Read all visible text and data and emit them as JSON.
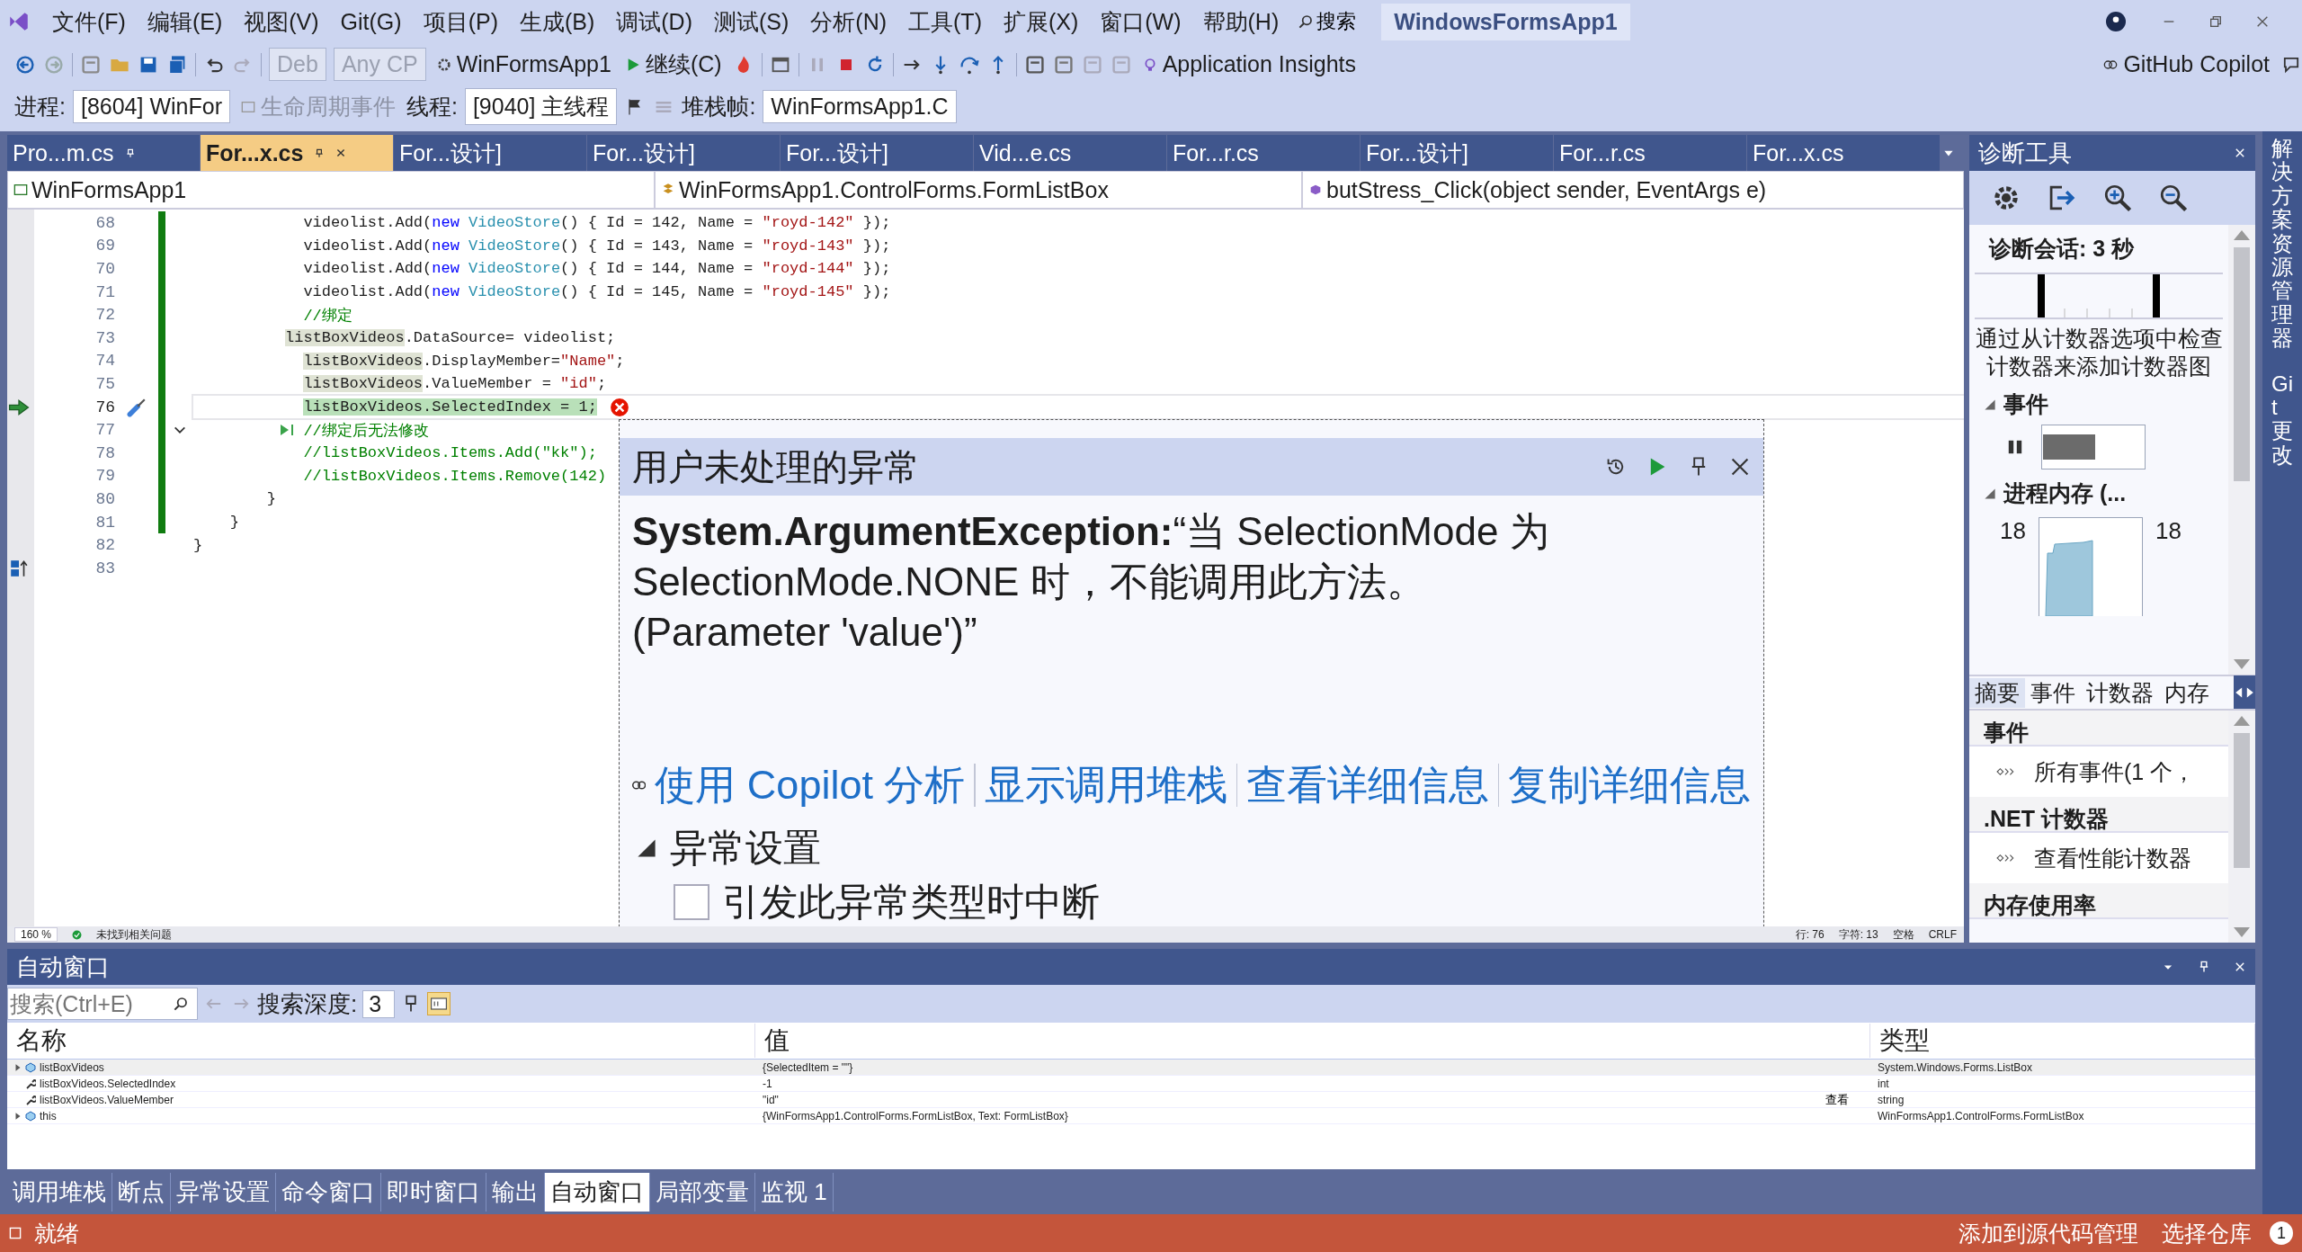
{
  "menu": [
    "文件(F)",
    "编辑(E)",
    "视图(V)",
    "Git(G)",
    "项目(P)",
    "生成(B)",
    "调试(D)",
    "测试(S)",
    "分析(N)",
    "工具(T)",
    "扩展(X)",
    "窗口(W)",
    "帮助(H)"
  ],
  "search_button": "搜索",
  "window_title": "WindowsFormsApp1",
  "toolbar": {
    "configuration": "Deb",
    "platform": "Any CP",
    "startup_project": "WinFormsApp1",
    "continue_button": "继续(C)",
    "insights_button": "Application Insights",
    "copilot_button": "GitHub Copilot"
  },
  "debug_location": {
    "process_label": "进程:",
    "process": "[8604] WinFor",
    "lifecycle_events": "生命周期事件",
    "thread_label": "线程:",
    "thread": "[9040] 主线程",
    "stack_frame_label": "堆栈帧:",
    "stack_frame": "WinFormsApp1.C"
  },
  "document_tabs": [
    {
      "label": "Pro...m.cs",
      "selected": false,
      "pinned": true
    },
    {
      "label": "For...x.cs",
      "selected": true,
      "pinned": false
    },
    {
      "label": "For...设计]",
      "selected": false,
      "pinned": false
    },
    {
      "label": "For...设计]",
      "selected": false,
      "pinned": false
    },
    {
      "label": "For...设计]",
      "selected": false,
      "pinned": false
    },
    {
      "label": "Vid...e.cs",
      "selected": false,
      "pinned": false
    },
    {
      "label": "For...r.cs",
      "selected": false,
      "pinned": false
    },
    {
      "label": "For...设计]",
      "selected": false,
      "pinned": false
    },
    {
      "label": "For...r.cs",
      "selected": false,
      "pinned": false
    },
    {
      "label": "For...x.cs",
      "selected": false,
      "pinned": false
    }
  ],
  "nav_bar": {
    "project": "WinFormsApp1",
    "type": "WinFormsApp1.ControlForms.FormListBox",
    "member": "butStress_Click(object sender, EventArgs e)"
  },
  "code_lines": [
    {
      "number": "68",
      "kind": "plain",
      "changed": true,
      "segments": [
        {
          "text": "            videolist.Add(",
          "kind": "plain"
        },
        {
          "text": "new",
          "kind": "keyword"
        },
        {
          "text": " VideoStore",
          "kind": "type"
        },
        {
          "text": "() { Id = 142, Name = ",
          "kind": "plain"
        },
        {
          "text": "\"royd-142\"",
          "kind": "string"
        },
        {
          "text": " });",
          "kind": "plain"
        }
      ]
    },
    {
      "number": "69",
      "kind": "plain",
      "changed": true,
      "segments": [
        {
          "text": "            videolist.Add(",
          "kind": "plain"
        },
        {
          "text": "new",
          "kind": "keyword"
        },
        {
          "text": " VideoStore",
          "kind": "type"
        },
        {
          "text": "() { Id = 143, Name = ",
          "kind": "plain"
        },
        {
          "text": "\"royd-143\"",
          "kind": "string"
        },
        {
          "text": " });",
          "kind": "plain"
        }
      ]
    },
    {
      "number": "70",
      "kind": "plain",
      "changed": true,
      "segments": [
        {
          "text": "            videolist.Add(",
          "kind": "plain"
        },
        {
          "text": "new",
          "kind": "keyword"
        },
        {
          "text": " VideoStore",
          "kind": "type"
        },
        {
          "text": "() { Id = 144, Name = ",
          "kind": "plain"
        },
        {
          "text": "\"royd-144\"",
          "kind": "string"
        },
        {
          "text": " });",
          "kind": "plain"
        }
      ]
    },
    {
      "number": "71",
      "kind": "plain",
      "changed": true,
      "segments": [
        {
          "text": "            videolist.Add(",
          "kind": "plain"
        },
        {
          "text": "new",
          "kind": "keyword"
        },
        {
          "text": " VideoStore",
          "kind": "type"
        },
        {
          "text": "() { Id = 145, Name = ",
          "kind": "plain"
        },
        {
          "text": "\"royd-145\"",
          "kind": "string"
        },
        {
          "text": " });",
          "kind": "plain"
        }
      ]
    },
    {
      "number": "72",
      "kind": "plain",
      "changed": true,
      "segments": [
        {
          "text": "            //绑定",
          "kind": "comment"
        }
      ]
    },
    {
      "number": "73",
      "kind": "plain",
      "changed": true,
      "segments": [
        {
          "text": "          listBoxVideos",
          "kind": "reference"
        },
        {
          "text": ".DataSource= videolist;",
          "kind": "plain"
        }
      ]
    },
    {
      "number": "74",
      "kind": "plain",
      "changed": true,
      "segments": [
        {
          "text": "            listBoxVideos",
          "kind": "reference"
        },
        {
          "text": ".DisplayMember=",
          "kind": "plain"
        },
        {
          "text": "\"Name\"",
          "kind": "string"
        },
        {
          "text": ";",
          "kind": "plain"
        }
      ]
    },
    {
      "number": "75",
      "kind": "plain",
      "changed": true,
      "segments": [
        {
          "text": "            listBoxVideos",
          "kind": "reference"
        },
        {
          "text": ".ValueMember = ",
          "kind": "plain"
        },
        {
          "text": "\"id\"",
          "kind": "string"
        },
        {
          "text": ";",
          "kind": "plain"
        }
      ]
    },
    {
      "number": "76",
      "kind": "next_statement",
      "changed": true,
      "error": true,
      "segments": [
        {
          "text": "            listBoxVideos.SelectedIndex = 1;",
          "kind": "statement"
        }
      ]
    },
    {
      "number": "77",
      "kind": "run_to_click",
      "changed": true,
      "collapsible": true,
      "segments": [
        {
          "text": "            //绑定后无法修改",
          "kind": "comment"
        }
      ]
    },
    {
      "number": "78",
      "kind": "plain",
      "changed": true,
      "segments": [
        {
          "text": "            //listBoxVideos.Items.Add(\"kk\");",
          "kind": "comment"
        }
      ]
    },
    {
      "number": "79",
      "kind": "plain",
      "changed": true,
      "segments": [
        {
          "text": "            //listBoxVideos.Items.Remove(142)",
          "kind": "comment"
        }
      ]
    },
    {
      "number": "80",
      "kind": "plain",
      "changed": true,
      "segments": [
        {
          "text": "        }",
          "kind": "plain"
        }
      ]
    },
    {
      "number": "81",
      "kind": "plain",
      "changed": true,
      "segments": [
        {
          "text": "    }",
          "kind": "plain"
        }
      ]
    },
    {
      "number": "82",
      "kind": "plain",
      "changed": false,
      "segments": [
        {
          "text": "}",
          "kind": "plain"
        }
      ]
    },
    {
      "number": "83",
      "kind": "tool",
      "changed": false
    }
  ],
  "exception_popup": {
    "title": "用户未处理的异常",
    "message": "**System.ArgumentException:**“当 SelectionMode 为 SelectionMode.NONE 时，不能调用此方法。 (Parameter 'value')”",
    "links": [
      "使用 Copilot 分析",
      "显示调用堆栈",
      "查看详细信息",
      "复制详细信息"
    ],
    "settings": {
      "label": "异常设置",
      "expanded": true,
      "break_option": {
        "label": "引发此异常类型时中断",
        "checked": false
      }
    }
  },
  "editor_status": {
    "zoom": "160 %",
    "issues": "未找到相关问题",
    "line": "行: 76",
    "char": "字符: 13",
    "spaces": "空格",
    "line_ending": "CRLF"
  },
  "diagnostic_tools": {
    "title": "诊断工具",
    "session": "诊断会话: 3 秒",
    "hint": "通过从计数器选项中检查计数器来添加计数器图",
    "events_section": {
      "label": "事件",
      "expanded": true
    },
    "memory_section": {
      "label": "进程内存 (...",
      "expanded": true,
      "left_label": "18",
      "right_label": "18"
    },
    "tabs": [
      {
        "label": "摘要",
        "selected": true
      },
      {
        "label": "事件",
        "selected": false
      },
      {
        "label": "计数器",
        "selected": false
      },
      {
        "label": "内存",
        "selected": false
      }
    ],
    "summary": [
      {
        "kind": "header",
        "label": "事件"
      },
      {
        "kind": "link",
        "label": "所有事件(1 个，"
      },
      {
        "kind": "header",
        "label": ".NET 计数器"
      },
      {
        "kind": "link",
        "label": "查看性能计数器"
      },
      {
        "kind": "header",
        "label": "内存使用率"
      }
    ]
  },
  "autos_window": {
    "title": "自动窗口",
    "search_placeholder": "搜索(Ctrl+E)",
    "depth_label": "搜索深度:",
    "depth": "3",
    "columns": [
      "名称",
      "值",
      "类型"
    ],
    "rows": [
      {
        "name": "listBoxVideos",
        "value": "{SelectedItem = \"\"}",
        "type": "System.Windows.Forms.ListBox",
        "expandable": true,
        "selected": true,
        "kind": "object"
      },
      {
        "name": "listBoxVideos.SelectedIndex",
        "value": "-1",
        "type": "int",
        "expandable": false,
        "selected": false,
        "kind": "property"
      },
      {
        "name": "listBoxVideos.ValueMember",
        "value": "\"id\"",
        "type": "string",
        "expandable": false,
        "selected": false,
        "kind": "property",
        "viewer": "查看"
      },
      {
        "name": "this",
        "value": "{WinFormsApp1.ControlForms.FormListBox, Text: FormListBox}",
        "type": "WinFormsApp1.ControlForms.FormListBox",
        "expandable": true,
        "selected": false,
        "kind": "object"
      }
    ]
  },
  "bottom_tabs": [
    {
      "label": "调用堆栈",
      "selected": false
    },
    {
      "label": "断点",
      "selected": false
    },
    {
      "label": "异常设置",
      "selected": false
    },
    {
      "label": "命令窗口",
      "selected": false
    },
    {
      "label": "即时窗口",
      "selected": false
    },
    {
      "label": "输出",
      "selected": false
    },
    {
      "label": "自动窗口",
      "selected": true
    },
    {
      "label": "局部变量",
      "selected": false
    },
    {
      "label": "监视 1",
      "selected": false
    }
  ],
  "side_tabs": [
    "解决方案资源管理器",
    "Git 更改"
  ],
  "status_bar": {
    "state": "就绪",
    "source_control": "添加到源代码管理",
    "repository": "选择仓库",
    "notifications": "1"
  }
}
